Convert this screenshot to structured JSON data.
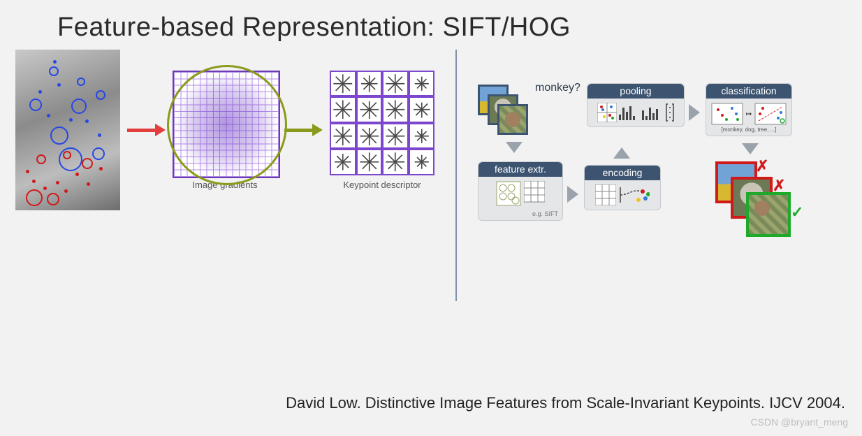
{
  "title": "Feature-based Representation: SIFT/HOG",
  "citation": "David Low. Distinctive Image Features from Scale-Invariant Keypoints. IJCV 2004.",
  "watermark": "CSDN @bryant_meng",
  "left": {
    "caption_gradients": "Image gradients",
    "caption_descriptor": "Keypoint descriptor"
  },
  "pipeline": {
    "query_label": "monkey?",
    "feature_extr": {
      "title": "feature extr.",
      "note": "e.g. SIFT"
    },
    "encoding": {
      "title": "encoding"
    },
    "pooling": {
      "title": "pooling"
    },
    "classification": {
      "title": "classification",
      "labels_line": "[monkey, dog, tree, ...]",
      "labels": [
        "monkey",
        "dog",
        "tree",
        "..."
      ]
    }
  }
}
